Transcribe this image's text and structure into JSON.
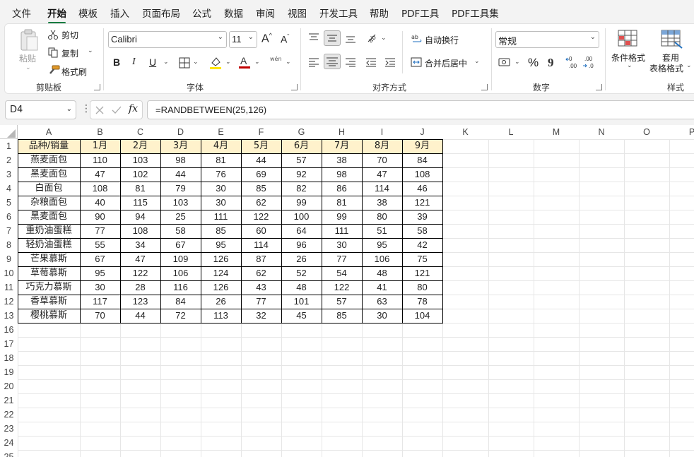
{
  "menu_tabs": [
    "文件",
    "开始",
    "模板",
    "插入",
    "页面布局",
    "公式",
    "数据",
    "审阅",
    "视图",
    "开发工具",
    "帮助",
    "PDF工具",
    "PDF工具集"
  ],
  "active_tab": "开始",
  "clipboard": {
    "paste": "粘贴",
    "cut": "剪切",
    "copy": "复制",
    "format_painter": "格式刷",
    "group": "剪贴板"
  },
  "font": {
    "name": "Calibri",
    "size": "11",
    "bold": "B",
    "italic": "I",
    "underline": "U",
    "group": "字体",
    "phonetic": "wén"
  },
  "alignment": {
    "wrap": "自动换行",
    "merge": "合并后居中",
    "group": "对齐方式"
  },
  "number": {
    "format": "常规",
    "percent": "%",
    "group": "数字"
  },
  "styles": {
    "conditional": "条件格式",
    "table_line1": "套用",
    "table_line2": "表格格式",
    "group": "样式"
  },
  "formula_bar": {
    "cell_ref": "D4",
    "formula": "=RANDBETWEEN(25,126)",
    "fx": "fx"
  },
  "columns": [
    "A",
    "B",
    "C",
    "D",
    "E",
    "F",
    "G",
    "H",
    "I",
    "J",
    "K",
    "L",
    "M",
    "N",
    "O",
    "P"
  ],
  "row_numbers": [
    "1",
    "2",
    "3",
    "4",
    "5",
    "6",
    "7",
    "8",
    "9",
    "10",
    "11",
    "12",
    "13",
    "16",
    "17",
    "18",
    "19",
    "20",
    "21",
    "22",
    "23",
    "24",
    "25"
  ],
  "table": {
    "headers": [
      "品种/销量",
      "1月",
      "2月",
      "3月",
      "4月",
      "5月",
      "6月",
      "7月",
      "8月",
      "9月"
    ],
    "rows": [
      [
        "燕麦面包",
        "110",
        "103",
        "98",
        "81",
        "44",
        "57",
        "38",
        "70",
        "84"
      ],
      [
        "黑麦面包",
        "47",
        "102",
        "44",
        "76",
        "69",
        "92",
        "98",
        "47",
        "108"
      ],
      [
        "白面包",
        "108",
        "81",
        "79",
        "30",
        "85",
        "82",
        "86",
        "114",
        "46"
      ],
      [
        "杂粮面包",
        "40",
        "115",
        "103",
        "30",
        "62",
        "99",
        "81",
        "38",
        "121"
      ],
      [
        "黑麦面包",
        "90",
        "94",
        "25",
        "111",
        "122",
        "100",
        "99",
        "80",
        "39"
      ],
      [
        "重奶油蛋糕",
        "77",
        "108",
        "58",
        "85",
        "60",
        "64",
        "111",
        "51",
        "58"
      ],
      [
        "轻奶油蛋糕",
        "55",
        "34",
        "67",
        "95",
        "114",
        "96",
        "30",
        "95",
        "42"
      ],
      [
        "芒果慕斯",
        "67",
        "47",
        "109",
        "126",
        "87",
        "26",
        "77",
        "106",
        "75"
      ],
      [
        "草莓慕斯",
        "95",
        "122",
        "106",
        "124",
        "62",
        "52",
        "54",
        "48",
        "121"
      ],
      [
        "巧克力慕斯",
        "30",
        "28",
        "116",
        "126",
        "43",
        "48",
        "122",
        "41",
        "80"
      ],
      [
        "香草慕斯",
        "117",
        "123",
        "84",
        "26",
        "77",
        "101",
        "57",
        "63",
        "78"
      ],
      [
        "樱桃慕斯",
        "70",
        "44",
        "72",
        "113",
        "32",
        "45",
        "85",
        "30",
        "104"
      ]
    ]
  },
  "colors": {
    "header_fill": "#fff2cc",
    "accent": "#107c41",
    "border": "#000000"
  }
}
